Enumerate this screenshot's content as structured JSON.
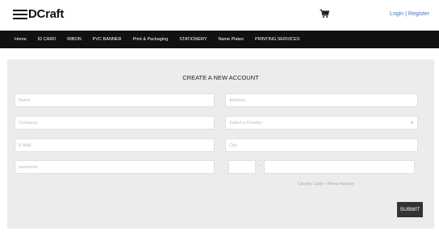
{
  "header": {
    "logo_text": "DCraft",
    "login_label": "Login",
    "separator": "|",
    "register_label": "Register"
  },
  "nav": {
    "items": [
      "Home",
      "ID CARD",
      "RIBON",
      "PVC BANNER",
      "Print & Packaging",
      "STATIONERY",
      "Name Plates",
      "PRINTING SERVICES"
    ]
  },
  "form": {
    "title": "CREATE A NEW ACCOUNT",
    "name_placeholder": "Name",
    "company_placeholder": "Company",
    "email_placeholder": "E-Mail",
    "password_placeholder": "password",
    "address_placeholder": "Address",
    "country_placeholder": "Select a Country",
    "city_placeholder": "City",
    "dash": "-",
    "phone_hint": "Country Code + Phone Number",
    "submit_label": "SUBMIT"
  }
}
